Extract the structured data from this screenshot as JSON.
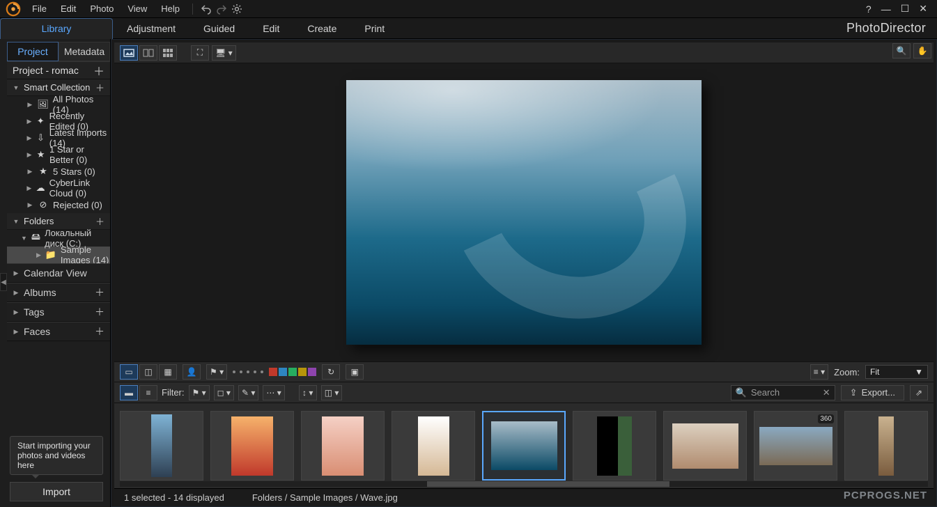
{
  "menubar": {
    "items": [
      "File",
      "Edit",
      "Photo",
      "View",
      "Help"
    ]
  },
  "window": {
    "help": "?",
    "min": "—",
    "max": "☐",
    "close": "✕"
  },
  "modes": {
    "items": [
      "Library",
      "Adjustment",
      "Guided",
      "Edit",
      "Create",
      "Print"
    ],
    "active": 0
  },
  "brand": "PhotoDirector",
  "sidebar": {
    "tabs": [
      "Project",
      "Metadata"
    ],
    "project_header": "Project - romac",
    "smart_collection": {
      "label": "Smart Collection",
      "items": [
        "All Photos (14)",
        "Recently Edited (0)",
        "Latest Imports (14)",
        "1 Star or Better (0)",
        "5 Stars (0)",
        "CyberLink Cloud (0)",
        "Rejected (0)"
      ]
    },
    "folders": {
      "label": "Folders",
      "drive": "Локальный диск (C:)",
      "sub": "Sample Images (14)"
    },
    "sections": [
      "Calendar View",
      "Albums",
      "Tags",
      "Faces"
    ],
    "hint": "Start importing your photos and videos here",
    "import": "Import"
  },
  "midbar": {
    "zoom_label": "Zoom:",
    "zoom_value": "Fit"
  },
  "filmbar": {
    "filter_label": "Filter:",
    "search_placeholder": "Search",
    "export": "Export..."
  },
  "status": {
    "selection": "1 selected - 14 displayed",
    "path": "Folders / Sample Images / Wave.jpg"
  },
  "watermark": "PCPROGS.NET",
  "colors": [
    "#c0392b",
    "#2e86c1",
    "#27ae60",
    "#b7950b",
    "#8e44ad"
  ]
}
